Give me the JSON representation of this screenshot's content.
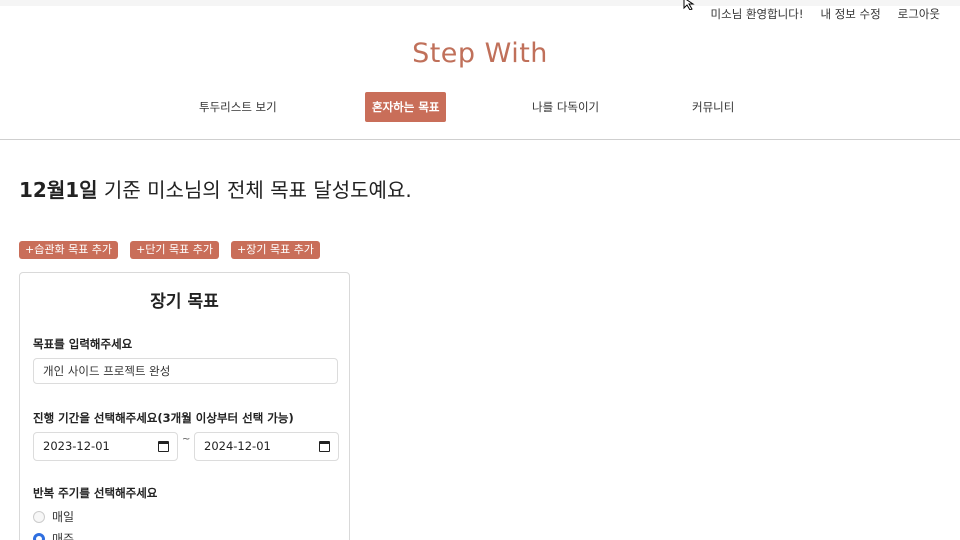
{
  "header": {
    "welcome": "미소님 환영합니다!",
    "edit_profile": "내 정보 수정",
    "logout": "로그아웃",
    "brand": "Step With"
  },
  "nav": {
    "items": [
      {
        "label": "투두리스트 보기"
      },
      {
        "label": "혼자하는 목표",
        "active": true
      },
      {
        "label": "나를 다독이기"
      },
      {
        "label": "커뮤니티"
      }
    ]
  },
  "headline": {
    "date": "12월1일",
    "rest": " 기준 미소님의 전체 목표 달성도예요."
  },
  "add_buttons": [
    "+습관화 목표 추가",
    "+단기 목표 추가",
    "+장기 목표 추가"
  ],
  "form": {
    "title": "장기 목표",
    "goal_label": "목표를 입력해주세요",
    "goal_value": "개인 사이드 프로젝트 완성",
    "period_label": "진행 기간을 선택해주세요(3개월 이상부터 선택 가능)",
    "start_date": "2023-12-01",
    "separator": "~",
    "end_date": "2024-12-01",
    "repeat_label": "반복 주기를 선택해주세요",
    "repeat_options": [
      {
        "label": "매일",
        "checked": false
      },
      {
        "label": "매주",
        "checked": true
      }
    ]
  },
  "colors": {
    "accent": "#c96e59",
    "brand": "#c0705a",
    "radio_selected": "#2f6fe0"
  }
}
